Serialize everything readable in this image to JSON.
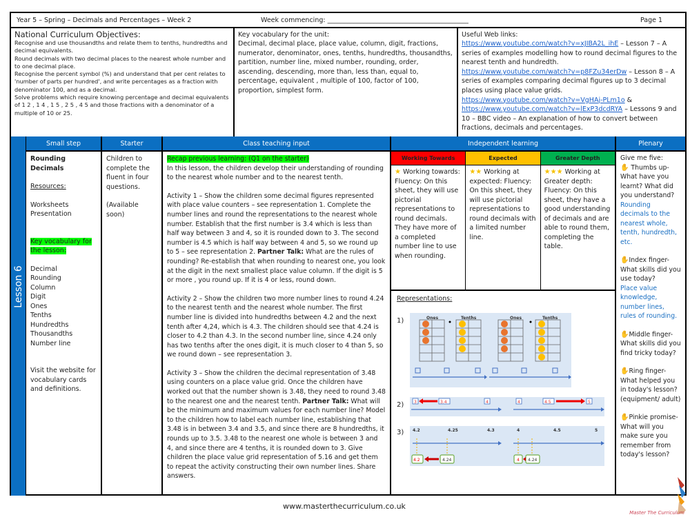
{
  "header": {
    "title": "Year 5 – Spring – Decimals and Percentages – Week 2",
    "week_commencing": "Week commencing: ___________________________________________",
    "page": "Page 1"
  },
  "objectives": {
    "title": "National Curriculum Objectives:",
    "items": [
      "Recognise and use thousandths and relate them to tenths, hundredths and decimal equivalents.",
      "Round decimals with two decimal places to the nearest whole number and to one decimal place.",
      "Recognise the percent symbol (%) and understand that per cent relates to 'number of parts per hundred', and write percentages as a fraction with denominator 100, and as a decimal.",
      "Solve problems which require knowing percentage and decimal equivalents of 1 2 , 1 4 , 1 5 , 2 5 , 4 5 and those fractions with a denominator of a multiple of 10 or 25."
    ]
  },
  "vocab_unit": {
    "title": "Key vocabulary for the unit:",
    "text": "Decimal, decimal place, place value, column, digit, fractions, numerator, denominator, ones, tenths, hundredths, thousandths, partition, number line, mixed number, rounding, order, ascending, descending, more than, less than, equal to, percentage, equivalent , multiple of 100, factor of 100, proportion, simplest form."
  },
  "web_links": {
    "title": "Useful Web links:",
    "link1": "https://www.youtube.com/watch?v=xJIBA2L_ihE",
    "desc1": " – Lesson 7 – A series of examples modelling how to round decimal figures to the nearest tenth and hundredth.",
    "link2": "https://www.youtube.com/watch?v=p8FZu34erDw",
    "desc2": " – Lesson 8 – A series of examples comparing decimal figures up to 3 decimal places using place value grids.",
    "link3": "https://www.youtube.com/watch?v=VgHAj-PLm1o",
    "amp": " & ",
    "link4": "https://www.youtube.com/watch?v=lExP3dcdRYA",
    "desc4": " – Lessons 9 and 10 – BBC video – An explanation of how to convert between fractions, decimals and percentages."
  },
  "lesson_label": "Lesson 6",
  "columns": {
    "small_step": "Small step",
    "starter": "Starter",
    "class_input": "Class teaching input",
    "independent": "Independent learning",
    "plenary": "Plenary"
  },
  "small_step": {
    "title": "Rounding Decimals",
    "resources_label": "Resources:",
    "resources": [
      "Worksheets",
      "Presentation"
    ],
    "vocab_label": "Key vocabulary for the lesson:",
    "vocab": [
      "Decimal",
      "Rounding",
      "Column",
      "Digit",
      "Ones",
      "Tenths",
      "Hundredths",
      "Thousandths",
      "Number line"
    ],
    "visit": "Visit the website for vocabulary cards and definitions."
  },
  "starter": {
    "text": "Children to complete the fluent in four questions.",
    "note": "(Available soon)"
  },
  "class_input": {
    "recap": "Recap previous learning: (Q1 on the starter)",
    "intro": "In this lesson, the children develop their understanding of rounding to the nearest whole number and to the nearest tenth.",
    "activity1_a": "Activity 1 – Show the children some decimal figures represented with place value counters – see representation 1. Complete the number lines and round the representations to the nearest whole number. Establish that the first number is 3.4 which is less than half way between 3 and 4, so it is rounded down to 3. The second number is 4.5 which is half way between 4 and 5, so we round up to 5 – see representation 2. ",
    "partner_talk": "Partner Talk:",
    "activity1_b": " What are the rules of rounding? Re-establish that when rounding to nearest one, you look at the digit in the next smallest place value column. If the digit is 5 or more , you round up. If it is 4 or less, round down.",
    "activity2": "Activity 2 – Show the children two more number lines to round 4.24 to the nearest tenth and the nearest whole number. The first number line is divided into hundredths between 4.2 and the next tenth after 4,24, which is 4.3. The children should see that 4.24 is closer to 4.2 than 4.3. In the second number line, since 4.24 only has two tenths after the ones digit, it is much closer to 4 than 5, so we round down – see representation 3.",
    "activity3_a": "Activity 3 – Show the children the decimal representation of 3.48 using counters on a place value grid. Once the children have worked out that the number shown is 3.48, they need to round 3.48 to the nearest one and the nearest tenth. ",
    "activity3_b": " What will be the minimum and maximum values for each number line? Model to the children how to label each number line, establishing that 3.48 is in between 3.4 and 3.5, and since there are 8 hundredths, it rounds up to 3.5. 3.48 to the nearest one whole is between 3 and 4, and since there are 4 tenths, it is rounded down to 3. Give children the place value grid representation of 5.16 and get them to repeat the activity constructing their own number lines. Share answers."
  },
  "independent": {
    "levels": [
      {
        "label": "Working Towards",
        "color": "#ff0000",
        "stars": "★",
        "text": "Working towards: Fluency: On this sheet, they will use pictorial representations to round decimals. They have more of a completed number line to use when rounding."
      },
      {
        "label": "Expected",
        "color": "#ffc000",
        "stars": "★★",
        "text": "Working at expected: Fluency: On this sheet, they will use pictorial representations to round decimals with a limited number line."
      },
      {
        "label": "Greater Depth",
        "color": "#00b050",
        "stars": "★★★",
        "text": "Working at Greater depth: Fluency: On this sheet, they have a good understanding of decimals and are able to round them, completing the table."
      }
    ],
    "representations_label": "Representations:",
    "rep1": {
      "num": "1)",
      "ones": "Ones",
      "tenths": "Tenths",
      "one_counter": "1",
      "tenth_counter": "0.1"
    },
    "rep2": {
      "num": "2)",
      "a": [
        "3",
        "3.4",
        "4"
      ],
      "b": [
        "4",
        "4.5",
        "5"
      ]
    },
    "rep3": {
      "num": "3)",
      "ticks_a": [
        "4.2",
        "4.25",
        "4.3"
      ],
      "ticks_b": [
        "4",
        "4.5",
        "5"
      ],
      "box_a": [
        "4.2",
        "4.24"
      ],
      "box_b": [
        "4",
        "4.24"
      ]
    }
  },
  "plenary": {
    "intro": "Give me five:",
    "thumb": "Thumbs up- What have you learnt? What did you understand?",
    "thumb_answer": "Rounding decimals to the nearest whole, tenth, hundredth, etc.",
    "index": "Index finger- What skills did you use today?",
    "index_answer": "Place value knowledge, number lines, rules of rounding.",
    "middle": "Middle finger- What skills did you find tricky today?",
    "ring": "Ring finger- What helped you in today's lesson? (equipment/ adult)",
    "pinkie": "Pinkie promise- What will you make sure you remember from today's lesson?"
  },
  "footer": {
    "url": "www.masterthecurriculum.co.uk",
    "brand": "Master The Curriculum"
  }
}
